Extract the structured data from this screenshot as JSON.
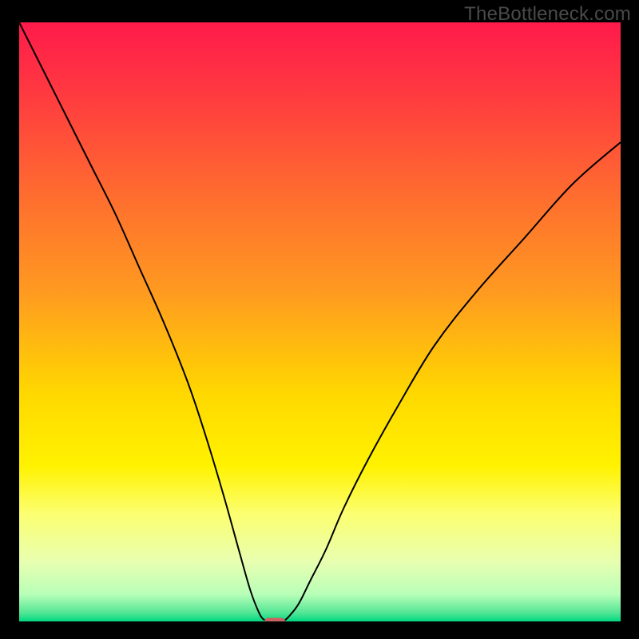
{
  "watermark": "TheBottleneck.com",
  "chart_data": {
    "type": "line",
    "title": "",
    "xlabel": "",
    "ylabel": "",
    "xlim": [
      0,
      100
    ],
    "ylim": [
      0,
      100
    ],
    "background": {
      "type": "vertical-gradient",
      "stops": [
        {
          "offset": 0.0,
          "color": "#ff1a4b"
        },
        {
          "offset": 0.12,
          "color": "#ff3a40"
        },
        {
          "offset": 0.28,
          "color": "#ff6a30"
        },
        {
          "offset": 0.45,
          "color": "#ff9a20"
        },
        {
          "offset": 0.62,
          "color": "#ffd800"
        },
        {
          "offset": 0.74,
          "color": "#fff200"
        },
        {
          "offset": 0.82,
          "color": "#fcff70"
        },
        {
          "offset": 0.9,
          "color": "#e8ffb0"
        },
        {
          "offset": 0.955,
          "color": "#b8ffb8"
        },
        {
          "offset": 0.985,
          "color": "#55e696"
        },
        {
          "offset": 1.0,
          "color": "#00d880"
        }
      ]
    },
    "curve": {
      "left_branch": {
        "x": [
          0,
          4,
          8,
          12,
          16,
          20,
          24,
          28,
          31,
          34,
          36.5,
          38.5,
          40.0,
          40.8
        ],
        "y": [
          100,
          92,
          84,
          76,
          68,
          59,
          50,
          40,
          31,
          21,
          12,
          5,
          1.2,
          0.2
        ]
      },
      "right_branch": {
        "x": [
          44.2,
          45,
          46.5,
          48.5,
          51,
          54,
          58,
          63,
          69,
          76,
          84,
          92,
          100
        ],
        "y": [
          0.2,
          1.0,
          3,
          7,
          12,
          19,
          27,
          36,
          46,
          55,
          64,
          73,
          80
        ]
      }
    },
    "marker": {
      "shape": "rounded-rect",
      "center_x": 42.5,
      "center_y": 0.0,
      "width": 3.4,
      "height": 1.2,
      "fill": "#cc6161",
      "stroke": "none"
    }
  }
}
